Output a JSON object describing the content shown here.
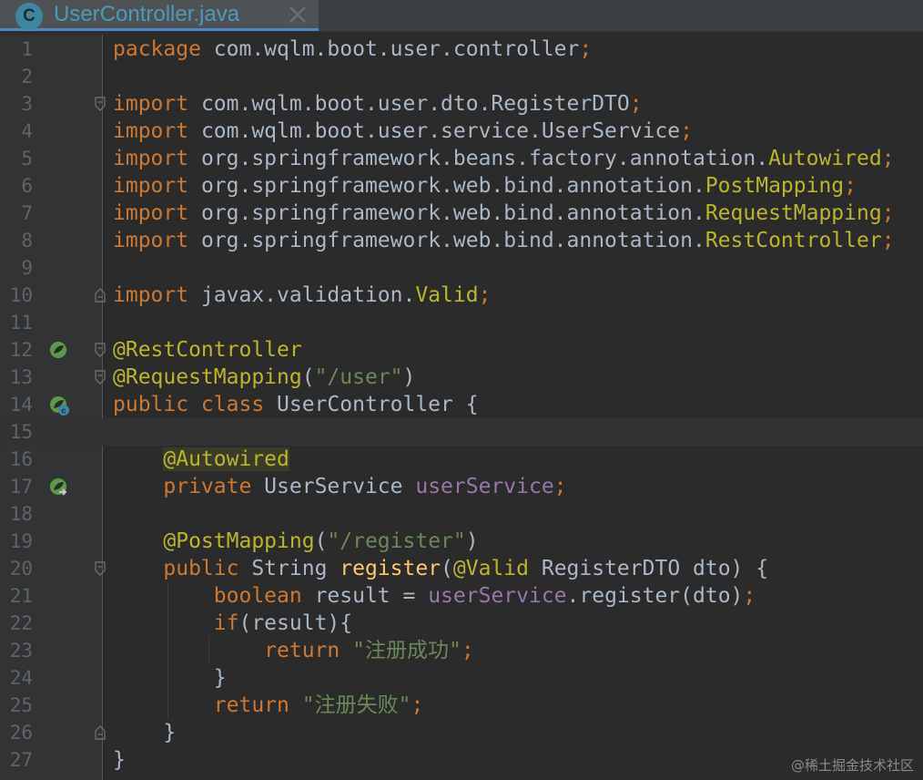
{
  "tab": {
    "icon_letter": "C",
    "title": "UserController.java",
    "close_icon": "close-icon"
  },
  "colors": {
    "background": "#2b2b2b",
    "keyword": "#cc7832",
    "annotation": "#bbb529",
    "string": "#6a8759",
    "field": "#9876aa",
    "method": "#ffc66d",
    "text": "#a9b7c6",
    "line_number": "#606366"
  },
  "gutter_icons": {
    "12": "bean-icon",
    "14": "class-bean-icon",
    "17": "autowired-navigate-icon"
  },
  "lines": [
    {
      "n": "1",
      "tokens": [
        {
          "t": "package",
          "c": "kw"
        },
        {
          "t": " com.wqlm.boot.user.controller",
          "c": ""
        },
        {
          "t": ";",
          "c": "kw"
        }
      ]
    },
    {
      "n": "2",
      "tokens": []
    },
    {
      "n": "3",
      "tokens": [
        {
          "t": "import",
          "c": "kw"
        },
        {
          "t": " com.wqlm.boot.user.dto.RegisterDTO",
          "c": ""
        },
        {
          "t": ";",
          "c": "kw"
        }
      ]
    },
    {
      "n": "4",
      "tokens": [
        {
          "t": "import",
          "c": "kw"
        },
        {
          "t": " com.wqlm.boot.user.service.UserService",
          "c": ""
        },
        {
          "t": ";",
          "c": "kw"
        }
      ]
    },
    {
      "n": "5",
      "tokens": [
        {
          "t": "import",
          "c": "kw"
        },
        {
          "t": " org.springframework.beans.factory.annotation.",
          "c": ""
        },
        {
          "t": "Autowired",
          "c": "an"
        },
        {
          "t": ";",
          "c": "kw"
        }
      ]
    },
    {
      "n": "6",
      "tokens": [
        {
          "t": "import",
          "c": "kw"
        },
        {
          "t": " org.springframework.web.bind.annotation.",
          "c": ""
        },
        {
          "t": "PostMapping",
          "c": "an"
        },
        {
          "t": ";",
          "c": "kw"
        }
      ]
    },
    {
      "n": "7",
      "tokens": [
        {
          "t": "import",
          "c": "kw"
        },
        {
          "t": " org.springframework.web.bind.annotation.",
          "c": ""
        },
        {
          "t": "RequestMapping",
          "c": "an"
        },
        {
          "t": ";",
          "c": "kw"
        }
      ]
    },
    {
      "n": "8",
      "tokens": [
        {
          "t": "import",
          "c": "kw"
        },
        {
          "t": " org.springframework.web.bind.annotation.",
          "c": ""
        },
        {
          "t": "RestController",
          "c": "an"
        },
        {
          "t": ";",
          "c": "kw"
        }
      ]
    },
    {
      "n": "9",
      "tokens": []
    },
    {
      "n": "10",
      "tokens": [
        {
          "t": "import",
          "c": "kw"
        },
        {
          "t": " javax.validation.",
          "c": ""
        },
        {
          "t": "Valid",
          "c": "an"
        },
        {
          "t": ";",
          "c": "kw"
        }
      ]
    },
    {
      "n": "11",
      "tokens": []
    },
    {
      "n": "12",
      "tokens": [
        {
          "t": "@RestController",
          "c": "an"
        }
      ]
    },
    {
      "n": "13",
      "tokens": [
        {
          "t": "@RequestMapping",
          "c": "an"
        },
        {
          "t": "(",
          "c": ""
        },
        {
          "t": "\"/user\"",
          "c": "str"
        },
        {
          "t": ")",
          "c": ""
        }
      ]
    },
    {
      "n": "14",
      "tokens": [
        {
          "t": "public class",
          "c": "kw"
        },
        {
          "t": " UserController {",
          "c": ""
        }
      ]
    },
    {
      "n": "15",
      "tokens": []
    },
    {
      "n": "16",
      "tokens": [
        {
          "t": "    ",
          "c": ""
        },
        {
          "t": "@Autowired",
          "c": "an hl"
        }
      ]
    },
    {
      "n": "17",
      "tokens": [
        {
          "t": "    ",
          "c": ""
        },
        {
          "t": "private",
          "c": "kw"
        },
        {
          "t": " UserService ",
          "c": ""
        },
        {
          "t": "userService",
          "c": "fld"
        },
        {
          "t": ";",
          "c": "kw"
        }
      ]
    },
    {
      "n": "18",
      "tokens": []
    },
    {
      "n": "19",
      "tokens": [
        {
          "t": "    ",
          "c": ""
        },
        {
          "t": "@PostMapping",
          "c": "an"
        },
        {
          "t": "(",
          "c": ""
        },
        {
          "t": "\"/register\"",
          "c": "str"
        },
        {
          "t": ")",
          "c": ""
        }
      ]
    },
    {
      "n": "20",
      "tokens": [
        {
          "t": "    ",
          "c": ""
        },
        {
          "t": "public",
          "c": "kw"
        },
        {
          "t": " String ",
          "c": ""
        },
        {
          "t": "register",
          "c": "fn"
        },
        {
          "t": "(",
          "c": ""
        },
        {
          "t": "@Valid",
          "c": "an"
        },
        {
          "t": " RegisterDTO dto) {",
          "c": ""
        }
      ]
    },
    {
      "n": "21",
      "tokens": [
        {
          "t": "        ",
          "c": ""
        },
        {
          "t": "boolean",
          "c": "kw"
        },
        {
          "t": " result = ",
          "c": ""
        },
        {
          "t": "userService",
          "c": "fld"
        },
        {
          "t": ".register(dto)",
          "c": ""
        },
        {
          "t": ";",
          "c": "kw"
        }
      ]
    },
    {
      "n": "22",
      "tokens": [
        {
          "t": "        ",
          "c": ""
        },
        {
          "t": "if",
          "c": "kw"
        },
        {
          "t": "(result){",
          "c": ""
        }
      ]
    },
    {
      "n": "23",
      "tokens": [
        {
          "t": "            ",
          "c": ""
        },
        {
          "t": "return",
          "c": "kw"
        },
        {
          "t": " ",
          "c": ""
        },
        {
          "t": "\"注册成功\"",
          "c": "str"
        },
        {
          "t": ";",
          "c": "kw"
        }
      ]
    },
    {
      "n": "24",
      "tokens": [
        {
          "t": "        }",
          "c": ""
        }
      ]
    },
    {
      "n": "25",
      "tokens": [
        {
          "t": "        ",
          "c": ""
        },
        {
          "t": "return",
          "c": "kw"
        },
        {
          "t": " ",
          "c": ""
        },
        {
          "t": "\"注册失败\"",
          "c": "str"
        },
        {
          "t": ";",
          "c": "kw"
        }
      ]
    },
    {
      "n": "26",
      "tokens": [
        {
          "t": "    }",
          "c": ""
        }
      ]
    },
    {
      "n": "27",
      "tokens": [
        {
          "t": "}",
          "c": ""
        }
      ]
    }
  ],
  "fold_markers": [
    "3",
    "10",
    "12",
    "13",
    "20",
    "26"
  ],
  "current_line": "15",
  "watermark": "@稀土掘金技术社区"
}
